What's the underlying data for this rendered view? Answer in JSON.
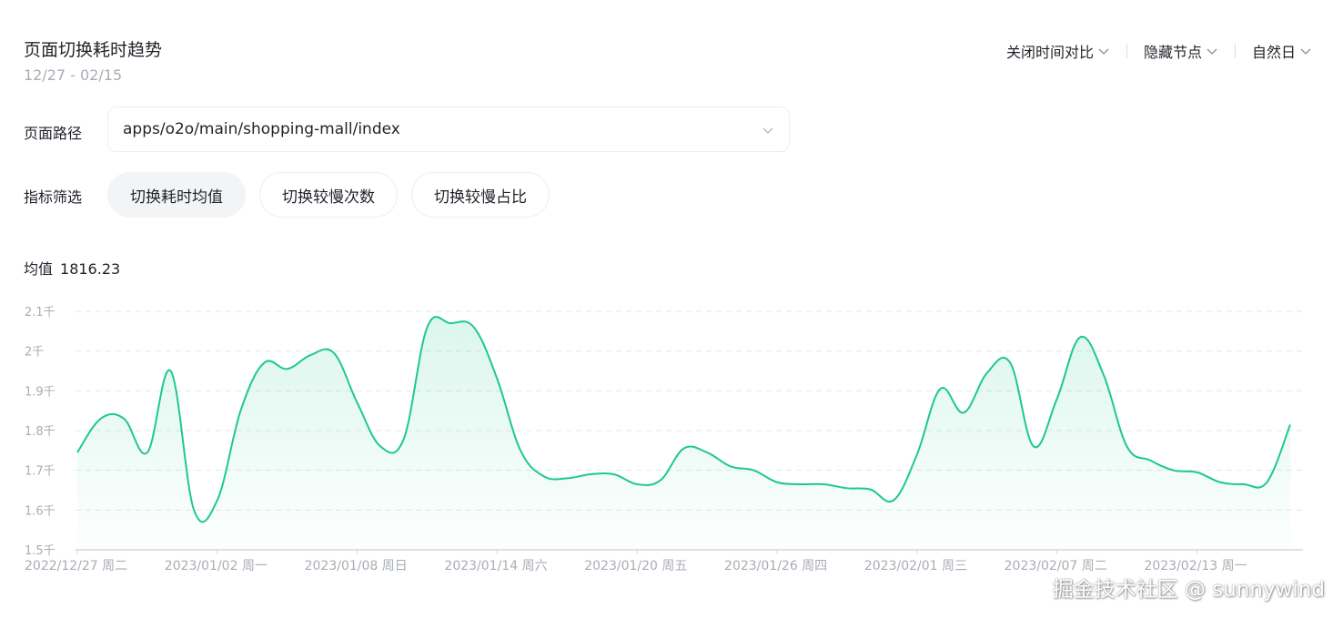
{
  "header": {
    "title": "页面切换耗时趋势",
    "date_range": "12/27 - 02/15"
  },
  "controls": {
    "compare": "关闭时间对比",
    "nodes": "隐藏节点",
    "granularity": "自然日"
  },
  "filters": {
    "path_label": "页面路径",
    "path_value": "apps/o2o/main/shopping-mall/index",
    "metric_label": "指标筛选",
    "chips": [
      "切换耗时均值",
      "切换较慢次数",
      "切换较慢占比"
    ],
    "active_chip": 0
  },
  "summary": {
    "label": "均值",
    "value": "1816.23"
  },
  "colors": {
    "line": "#1ec98b",
    "fill": "#1ec98b",
    "grid": "#e3e6ea",
    "axis_text": "#a8adb5"
  },
  "chart_data": {
    "type": "area",
    "ylim": [
      1500,
      2100
    ],
    "yticks": [
      {
        "value": 2100,
        "label": "2.1千"
      },
      {
        "value": 2000,
        "label": "2千"
      },
      {
        "value": 1900,
        "label": "1.9千"
      },
      {
        "value": 1800,
        "label": "1.8千"
      },
      {
        "value": 1700,
        "label": "1.7千"
      },
      {
        "value": 1600,
        "label": "1.6千"
      },
      {
        "value": 1500,
        "label": "1.5千"
      }
    ],
    "xticks": [
      {
        "index": 0,
        "label": "2022/12/27 周二"
      },
      {
        "index": 6,
        "label": "2023/01/02 周一"
      },
      {
        "index": 12,
        "label": "2023/01/08 周日"
      },
      {
        "index": 18,
        "label": "2023/01/14 周六"
      },
      {
        "index": 24,
        "label": "2023/01/20 周五"
      },
      {
        "index": 30,
        "label": "2023/01/26 周四"
      },
      {
        "index": 36,
        "label": "2023/02/01 周三"
      },
      {
        "index": 42,
        "label": "2023/02/07 周二"
      },
      {
        "index": 48,
        "label": "2023/02/13 周一"
      }
    ],
    "values": [
      1745,
      1830,
      1830,
      1745,
      1950,
      1600,
      1625,
      1850,
      1970,
      1955,
      1990,
      1995,
      1870,
      1760,
      1780,
      2060,
      2070,
      2060,
      1930,
      1750,
      1685,
      1680,
      1690,
      1690,
      1665,
      1675,
      1755,
      1745,
      1710,
      1700,
      1670,
      1665,
      1665,
      1655,
      1652,
      1625,
      1740,
      1905,
      1845,
      1945,
      1970,
      1760,
      1880,
      2035,
      1940,
      1760,
      1725,
      1700,
      1695,
      1670,
      1665,
      1670,
      1815
    ]
  },
  "watermark": "掘金技术社区 @ sunnywind"
}
